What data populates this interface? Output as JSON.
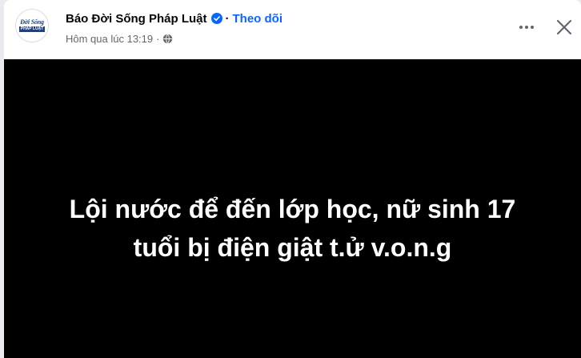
{
  "post": {
    "page_name": "Báo Đời Sống Pháp Luật",
    "separator": "·",
    "follow_label": "Theo dõi",
    "timestamp": "Hôm qua lúc 13:19",
    "meta_separator": "·",
    "audience_icon": "globe-icon",
    "verified_icon": "verified-badge-icon",
    "more_icon": "more-options-icon",
    "close_icon": "close-icon",
    "avatar_logo": {
      "line1": "Đời Sống",
      "line2": "PHÁP LUẬT"
    }
  },
  "media": {
    "headline_line1": "Lội nước để đến lớp học, nữ sinh 17",
    "headline_line2": "tuổi bị điện giật t.ử v.o.n.g"
  },
  "colors": {
    "accent": "#0866ff",
    "text_primary": "#050505",
    "text_secondary": "#65676b",
    "media_background": "#000000"
  }
}
